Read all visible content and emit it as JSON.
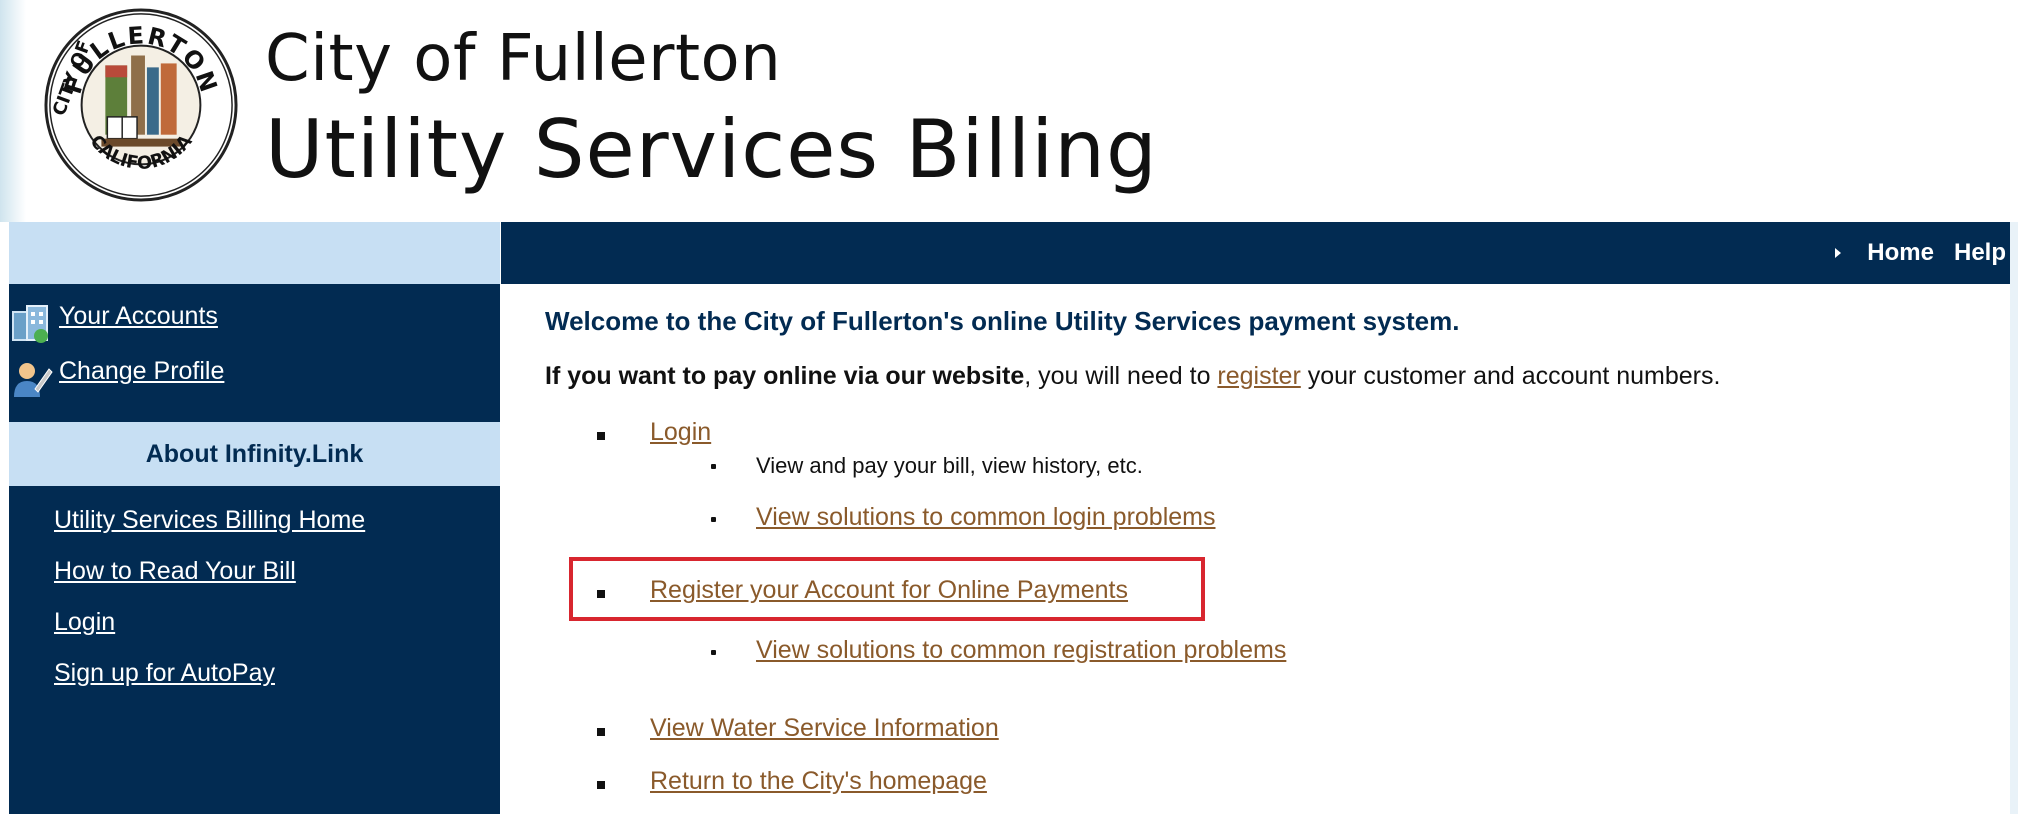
{
  "header": {
    "seal": {
      "top_text": "FULLERTON",
      "left_text": "CITY OF",
      "bottom_text": "CALIFORNIA"
    },
    "title_line1": "City of Fullerton",
    "title_line2": "Utility Services Billing"
  },
  "topnav": {
    "items": [
      "Home",
      "Help"
    ]
  },
  "sidebar": {
    "account_links": [
      {
        "label": "Your Accounts",
        "icon": "accounts-icon"
      },
      {
        "label": "Change Profile",
        "icon": "profile-icon"
      }
    ],
    "section_title": "About Infinity.Link",
    "links": [
      "Utility Services Billing Home",
      "How to Read Your Bill",
      "Login",
      "Sign up for AutoPay"
    ]
  },
  "main": {
    "welcome": "Welcome to the City of Fullerton's online Utility Services payment system.",
    "intro_bold": "If you want to pay online via our website",
    "intro_mid": ", you will need to ",
    "intro_link": "register",
    "intro_end": " your customer and account numbers.",
    "login_link": "Login",
    "login_sub": "View and pay your bill, view history, etc.",
    "login_problems": "View solutions to common login problems",
    "register_link": "Register your Account for Online Payments",
    "register_problems": "View solutions to common registration problems",
    "water_link": "View Water Service Information",
    "home_link": "Return to the City's homepage"
  },
  "colors": {
    "navy": "#022b52",
    "light_blue": "#c7dff3",
    "link_brown": "#8a5a2b",
    "highlight_red": "#d8262f"
  }
}
